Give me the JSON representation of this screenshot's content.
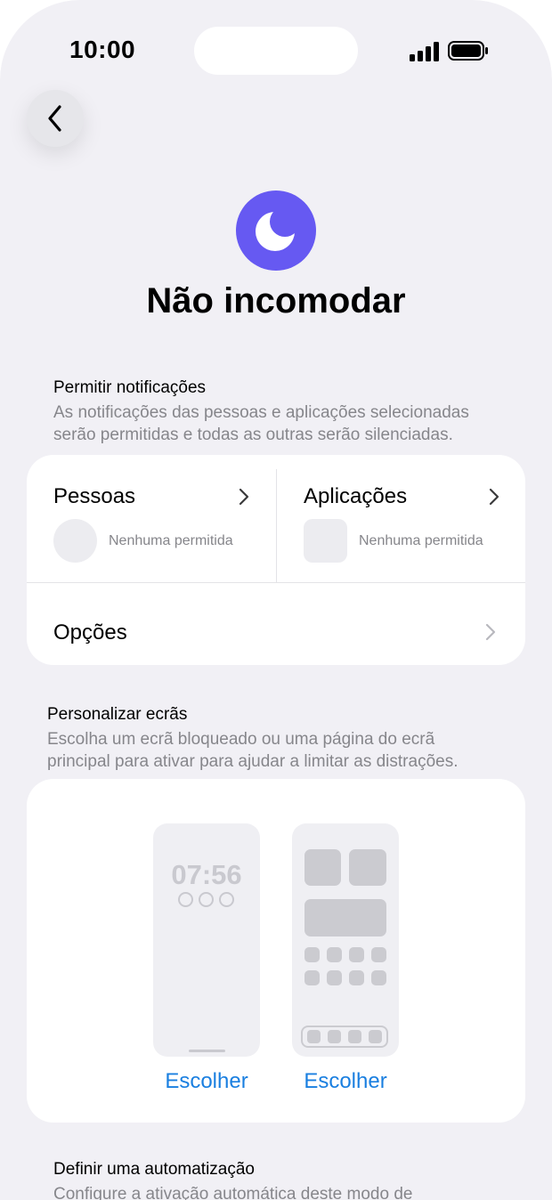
{
  "status": {
    "time": "10:00"
  },
  "header": {
    "title": "Não incomodar"
  },
  "notifications": {
    "title": "Permitir notificações",
    "subtitle_line1": "As notificações das pessoas e aplicações selecionadas",
    "subtitle_line2": "serão permitidas e todas as outras serão silenciadas.",
    "people_label": "Pessoas",
    "people_status": "Nenhuma permitida",
    "apps_label": "Aplicações",
    "apps_status": "Nenhuma permitida",
    "options_label": "Opções"
  },
  "screens": {
    "title": "Personalizar ecrãs",
    "subtitle_line1": "Escolha um ecrã bloqueado ou uma página do ecrã",
    "subtitle_line2": "principal para ativar para ajudar a limitar as distrações.",
    "lock_time": "07:56",
    "choose_left": "Escolher",
    "choose_right": "Escolher"
  },
  "automation": {
    "title": "Definir uma automatização",
    "subtitle_line1": "Configure a ativação automática deste modo de"
  },
  "colors": {
    "accent": "#6659f2",
    "link": "#1a7fe0",
    "background": "#f1f0f5"
  },
  "icons": [
    "back-chevron-icon",
    "moon-icon",
    "chevron-right-icon",
    "signal-icon",
    "battery-icon"
  ]
}
